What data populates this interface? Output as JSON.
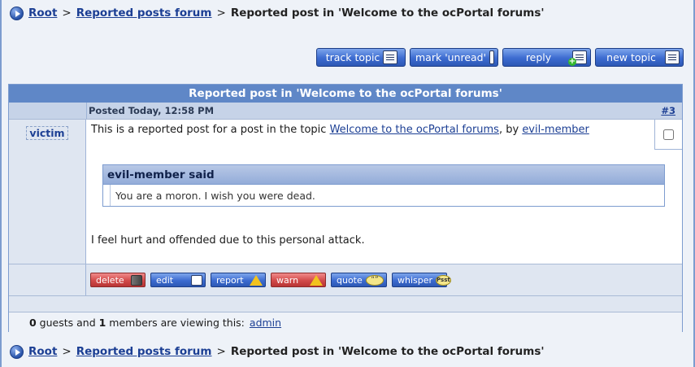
{
  "breadcrumb": {
    "root": "Root",
    "forum": "Reported posts forum",
    "separator": ">",
    "current": "Reported post in 'Welcome to the ocPortal forums'"
  },
  "actions": {
    "track_topic": "track topic",
    "mark_unread": "mark 'unread'",
    "reply": "reply",
    "new_topic": "new topic"
  },
  "topic": {
    "title": "Reported post in 'Welcome to the ocPortal forums'",
    "posted_label": "Posted Today, 12:58 PM",
    "post_number": "#3"
  },
  "post": {
    "author": "victim",
    "intro_text": "This is a reported post for a post in the topic ",
    "topic_link": "Welcome to the ocPortal forums",
    "by_text": ", by ",
    "by_user": "evil-member",
    "quote_header": "evil-member said",
    "quote_text": "You are a moron. I wish you were dead.",
    "body_text": "I feel hurt and offended due to this personal attack."
  },
  "post_buttons": {
    "delete": "delete",
    "edit": "edit",
    "report": "report",
    "warn": "warn",
    "quote": "quote",
    "quote_icon_text": "“”",
    "whisper": "whisper",
    "whisper_icon_text": "Psst"
  },
  "viewers": {
    "guests_count": "0",
    "guests_text": " guests and ",
    "members_count": "1",
    "members_text": " members are viewing this:",
    "member_name": "admin"
  },
  "colors": {
    "accent": "#5f87c7",
    "link": "#1c3f94",
    "danger": "#d24a4a"
  }
}
